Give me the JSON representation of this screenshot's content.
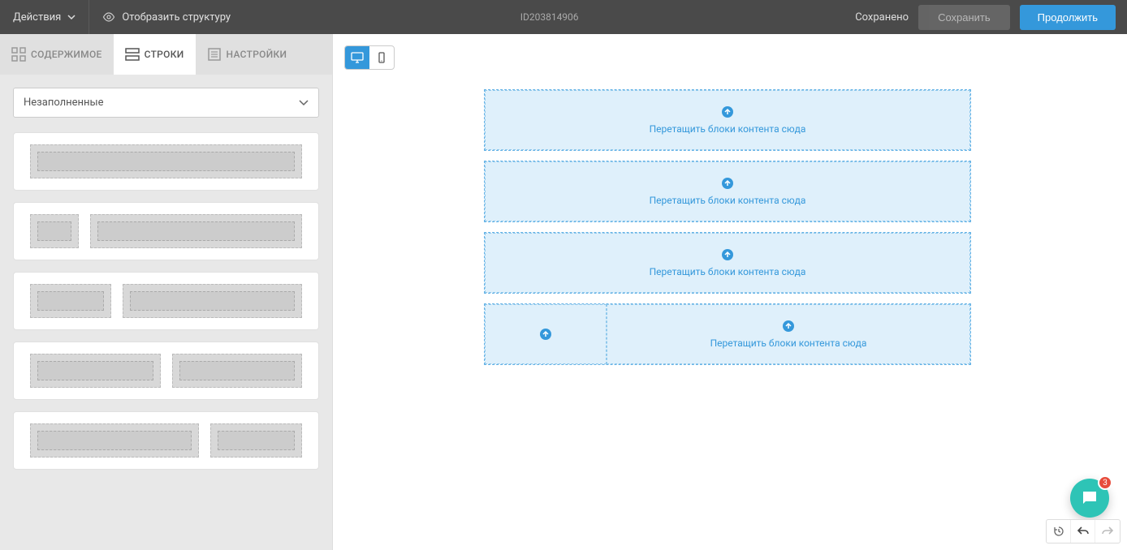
{
  "header": {
    "actions_label": "Действия",
    "structure_label": "Отобразить структуру",
    "doc_id": "ID203814906",
    "saved_label": "Сохранено",
    "save_btn": "Сохранить",
    "continue_btn": "Продолжить"
  },
  "tabs": {
    "content": "СОДЕРЖИМОЕ",
    "rows": "СТРОКИ",
    "settings": "НАСТРОЙКИ"
  },
  "dropdown": {
    "selected": "Незаполненные"
  },
  "canvas": {
    "drop_text": "Перетащить блоки контента сюда"
  },
  "chat": {
    "badge": "3"
  }
}
